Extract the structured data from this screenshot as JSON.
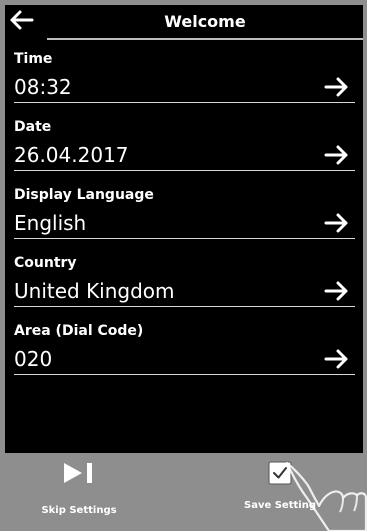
{
  "header": {
    "title": "Welcome",
    "back_icon": "arrow-left-icon"
  },
  "settings": [
    {
      "label": "Time",
      "value": "08:32"
    },
    {
      "label": "Date",
      "value": "26.04.2017"
    },
    {
      "label": "Display Language",
      "value": "English"
    },
    {
      "label": "Country",
      "value": "United Kingdom"
    },
    {
      "label": "Area (Dial Code)",
      "value": "020"
    }
  ],
  "footer": {
    "skip_label": "Skip Settings",
    "skip_icon": "skip-forward-icon",
    "save_label": "Save Setting",
    "save_icon": "checkmark-icon"
  },
  "colors": {
    "screen_background": "#000000",
    "footer_background": "#8e8e8e",
    "text": "#ffffff"
  }
}
